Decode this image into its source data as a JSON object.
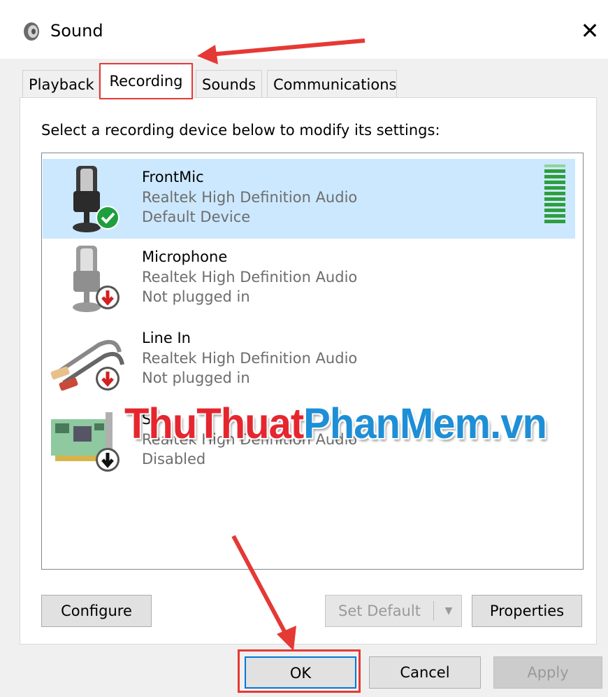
{
  "window": {
    "title": "Sound",
    "close_icon": "✕",
    "icon": "speaker-icon"
  },
  "tabs": [
    {
      "label": "Playback",
      "active": false
    },
    {
      "label": "Recording",
      "active": true
    },
    {
      "label": "Sounds",
      "active": false
    },
    {
      "label": "Communications",
      "active": false
    }
  ],
  "instruction": "Select a recording device below to modify its settings:",
  "devices": [
    {
      "name": "FrontMic",
      "driver": "Realtek High Definition Audio",
      "status": "Default Device",
      "icon": "microphone-icon",
      "badge": "check-badge-icon",
      "selected": true
    },
    {
      "name": "Microphone",
      "driver": "Realtek High Definition Audio",
      "status": "Not plugged in",
      "icon": "microphone-icon",
      "badge": "down-arrow-badge-icon",
      "selected": false
    },
    {
      "name": "Line In",
      "driver": "Realtek High Definition Audio",
      "status": "Not plugged in",
      "icon": "rca-cable-icon",
      "badge": "down-arrow-badge-icon",
      "selected": false
    },
    {
      "name": "S",
      "driver": "Realtek High Definition Audio",
      "status": "Disabled",
      "icon": "sound-card-icon",
      "badge": "down-arrow-badge-icon",
      "selected": false
    }
  ],
  "buttons": {
    "configure": "Configure",
    "set_default": "Set Default",
    "properties": "Properties",
    "ok": "OK",
    "cancel": "Cancel",
    "apply": "Apply"
  },
  "watermark": {
    "part1": "ThuThuat",
    "part2": "PhanMem.vn"
  },
  "colors": {
    "selection": "#cce8ff",
    "annotation": "#e53935",
    "level_meter": "#2e9e3e",
    "focus_border": "#0078d7"
  }
}
